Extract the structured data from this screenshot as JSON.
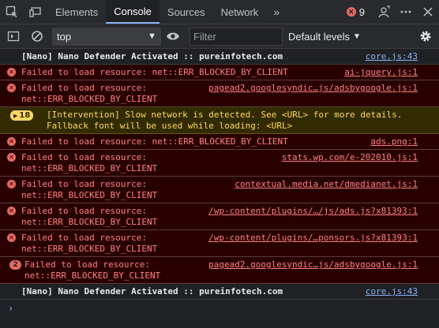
{
  "tabs": [
    {
      "label": "Elements"
    },
    {
      "label": "Console"
    },
    {
      "label": "Sources"
    },
    {
      "label": "Network"
    }
  ],
  "more_tabs_glyph": "»",
  "error_count": "9",
  "toolbar": {
    "context": "top",
    "filter_placeholder": "Filter",
    "levels_label": "Default levels"
  },
  "messages": [
    {
      "type": "info",
      "text": "[Nano] Nano Defender Activated :: pureinfotech.com",
      "source": "core.js:43"
    },
    {
      "type": "error",
      "text": "Failed to load resource: net::ERR_BLOCKED_BY_CLIENT",
      "source": "ai-jquery.js:1"
    },
    {
      "type": "error",
      "text": "Failed to load resource:\nnet::ERR_BLOCKED_BY_CLIENT",
      "source": "pagead2.googlesyndic…js/adsbygoogle.js:1"
    },
    {
      "type": "warn",
      "count": "18",
      "text": "[Intervention] Slow network is detected. See <URL> for more details.\nFallback font will be used while loading: <URL>",
      "source": ""
    },
    {
      "type": "error",
      "text": "Failed to load resource: net::ERR_BLOCKED_BY_CLIENT",
      "source": "ads.png:1"
    },
    {
      "type": "error",
      "text": "Failed to load resource:\nnet::ERR_BLOCKED_BY_CLIENT",
      "source": "stats.wp.com/e-202010.js:1"
    },
    {
      "type": "error",
      "text": "Failed to load resource:\nnet::ERR_BLOCKED_BY_CLIENT",
      "source": "contextual.media.net/dmedianet.js:1"
    },
    {
      "type": "error",
      "text": "Failed to load resource:\nnet::ERR_BLOCKED_BY_CLIENT",
      "source": "/wp-content/plugins/…/js/ads.js?x81393:1"
    },
    {
      "type": "error",
      "text": "Failed to load resource:\nnet::ERR_BLOCKED_BY_CLIENT",
      "source": "/wp-content/plugins/…ponsors.js?x81393:1"
    },
    {
      "type": "error",
      "count": "2",
      "text": "Failed to load resource:\nnet::ERR_BLOCKED_BY_CLIENT",
      "source": "pagead2.googlesyndic…js/adsbygoogle.js:1"
    },
    {
      "type": "info",
      "text": "[Nano] Nano Defender Activated :: pureinfotech.com",
      "source": "core.js:43"
    }
  ],
  "prompt_glyph": "›",
  "colors": {
    "error_bg": "#290000",
    "error_text": "#ff8080",
    "warn_bg": "#332b00",
    "warn_text": "#fdd663",
    "accent": "#8ab4f8"
  }
}
